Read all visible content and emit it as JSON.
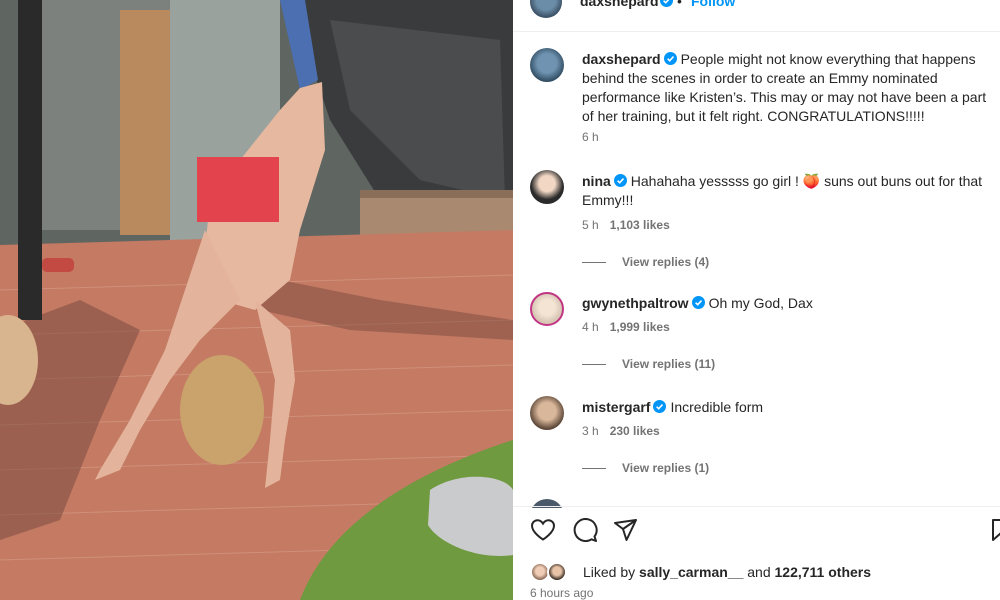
{
  "post": {
    "author": "daxshepard",
    "follow_label": "Follow",
    "caption_user": "daxshepard",
    "caption_text": "People might not know everything that happens behind the scenes in order to create an Emmy nominated performance like Kristen’s. This may or may not have been a part of her training, but it felt right. CONGRATULATIONS!!!!!",
    "caption_time": "6 h"
  },
  "comments": [
    {
      "user": "nina",
      "text": "Hahahaha yesssss go girl ! 🍑 suns out buns out for that Emmy!!!",
      "time": "5 h",
      "likes": "1,103 likes",
      "replies": "View replies (4)"
    },
    {
      "user": "gwynethpaltrow",
      "text": "Oh my God, Dax",
      "time": "4 h",
      "likes": "1,999 likes",
      "replies": "View replies (11)"
    },
    {
      "user": "mistergarf",
      "text": "Incredible form",
      "time": "3 h",
      "likes": "230 likes",
      "replies": "View replies (1)"
    }
  ],
  "likes_bar": {
    "prefix": "Liked by ",
    "user": "sally_carman__",
    "middle": " and ",
    "count": "122,711 others"
  },
  "posted_ago": "6 hours ago",
  "colors": {
    "link": "#0095f6",
    "verified": "#0095f6",
    "censor": "#e2434d",
    "muted": "#737373"
  },
  "icons": [
    "heart-icon",
    "comment-icon",
    "share-icon",
    "bookmark-icon",
    "verified-badge-icon"
  ]
}
